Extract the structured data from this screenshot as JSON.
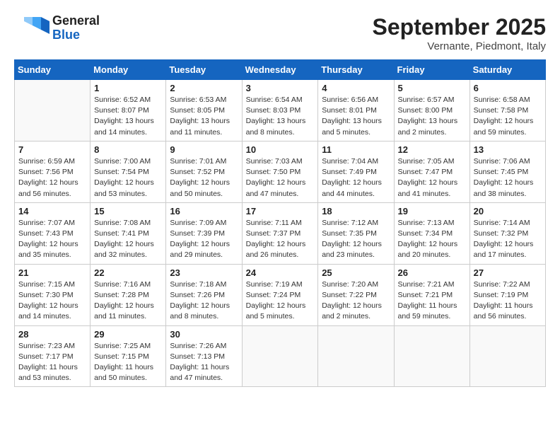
{
  "header": {
    "month": "September 2025",
    "location": "Vernante, Piedmont, Italy",
    "logo_general": "General",
    "logo_blue": "Blue"
  },
  "weekdays": [
    "Sunday",
    "Monday",
    "Tuesday",
    "Wednesday",
    "Thursday",
    "Friday",
    "Saturday"
  ],
  "weeks": [
    [
      {
        "day": "",
        "info": ""
      },
      {
        "day": "1",
        "info": "Sunrise: 6:52 AM\nSunset: 8:07 PM\nDaylight: 13 hours\nand 14 minutes."
      },
      {
        "day": "2",
        "info": "Sunrise: 6:53 AM\nSunset: 8:05 PM\nDaylight: 13 hours\nand 11 minutes."
      },
      {
        "day": "3",
        "info": "Sunrise: 6:54 AM\nSunset: 8:03 PM\nDaylight: 13 hours\nand 8 minutes."
      },
      {
        "day": "4",
        "info": "Sunrise: 6:56 AM\nSunset: 8:01 PM\nDaylight: 13 hours\nand 5 minutes."
      },
      {
        "day": "5",
        "info": "Sunrise: 6:57 AM\nSunset: 8:00 PM\nDaylight: 13 hours\nand 2 minutes."
      },
      {
        "day": "6",
        "info": "Sunrise: 6:58 AM\nSunset: 7:58 PM\nDaylight: 12 hours\nand 59 minutes."
      }
    ],
    [
      {
        "day": "7",
        "info": "Sunrise: 6:59 AM\nSunset: 7:56 PM\nDaylight: 12 hours\nand 56 minutes."
      },
      {
        "day": "8",
        "info": "Sunrise: 7:00 AM\nSunset: 7:54 PM\nDaylight: 12 hours\nand 53 minutes."
      },
      {
        "day": "9",
        "info": "Sunrise: 7:01 AM\nSunset: 7:52 PM\nDaylight: 12 hours\nand 50 minutes."
      },
      {
        "day": "10",
        "info": "Sunrise: 7:03 AM\nSunset: 7:50 PM\nDaylight: 12 hours\nand 47 minutes."
      },
      {
        "day": "11",
        "info": "Sunrise: 7:04 AM\nSunset: 7:49 PM\nDaylight: 12 hours\nand 44 minutes."
      },
      {
        "day": "12",
        "info": "Sunrise: 7:05 AM\nSunset: 7:47 PM\nDaylight: 12 hours\nand 41 minutes."
      },
      {
        "day": "13",
        "info": "Sunrise: 7:06 AM\nSunset: 7:45 PM\nDaylight: 12 hours\nand 38 minutes."
      }
    ],
    [
      {
        "day": "14",
        "info": "Sunrise: 7:07 AM\nSunset: 7:43 PM\nDaylight: 12 hours\nand 35 minutes."
      },
      {
        "day": "15",
        "info": "Sunrise: 7:08 AM\nSunset: 7:41 PM\nDaylight: 12 hours\nand 32 minutes."
      },
      {
        "day": "16",
        "info": "Sunrise: 7:09 AM\nSunset: 7:39 PM\nDaylight: 12 hours\nand 29 minutes."
      },
      {
        "day": "17",
        "info": "Sunrise: 7:11 AM\nSunset: 7:37 PM\nDaylight: 12 hours\nand 26 minutes."
      },
      {
        "day": "18",
        "info": "Sunrise: 7:12 AM\nSunset: 7:35 PM\nDaylight: 12 hours\nand 23 minutes."
      },
      {
        "day": "19",
        "info": "Sunrise: 7:13 AM\nSunset: 7:34 PM\nDaylight: 12 hours\nand 20 minutes."
      },
      {
        "day": "20",
        "info": "Sunrise: 7:14 AM\nSunset: 7:32 PM\nDaylight: 12 hours\nand 17 minutes."
      }
    ],
    [
      {
        "day": "21",
        "info": "Sunrise: 7:15 AM\nSunset: 7:30 PM\nDaylight: 12 hours\nand 14 minutes."
      },
      {
        "day": "22",
        "info": "Sunrise: 7:16 AM\nSunset: 7:28 PM\nDaylight: 12 hours\nand 11 minutes."
      },
      {
        "day": "23",
        "info": "Sunrise: 7:18 AM\nSunset: 7:26 PM\nDaylight: 12 hours\nand 8 minutes."
      },
      {
        "day": "24",
        "info": "Sunrise: 7:19 AM\nSunset: 7:24 PM\nDaylight: 12 hours\nand 5 minutes."
      },
      {
        "day": "25",
        "info": "Sunrise: 7:20 AM\nSunset: 7:22 PM\nDaylight: 12 hours\nand 2 minutes."
      },
      {
        "day": "26",
        "info": "Sunrise: 7:21 AM\nSunset: 7:21 PM\nDaylight: 11 hours\nand 59 minutes."
      },
      {
        "day": "27",
        "info": "Sunrise: 7:22 AM\nSunset: 7:19 PM\nDaylight: 11 hours\nand 56 minutes."
      }
    ],
    [
      {
        "day": "28",
        "info": "Sunrise: 7:23 AM\nSunset: 7:17 PM\nDaylight: 11 hours\nand 53 minutes."
      },
      {
        "day": "29",
        "info": "Sunrise: 7:25 AM\nSunset: 7:15 PM\nDaylight: 11 hours\nand 50 minutes."
      },
      {
        "day": "30",
        "info": "Sunrise: 7:26 AM\nSunset: 7:13 PM\nDaylight: 11 hours\nand 47 minutes."
      },
      {
        "day": "",
        "info": ""
      },
      {
        "day": "",
        "info": ""
      },
      {
        "day": "",
        "info": ""
      },
      {
        "day": "",
        "info": ""
      }
    ]
  ]
}
